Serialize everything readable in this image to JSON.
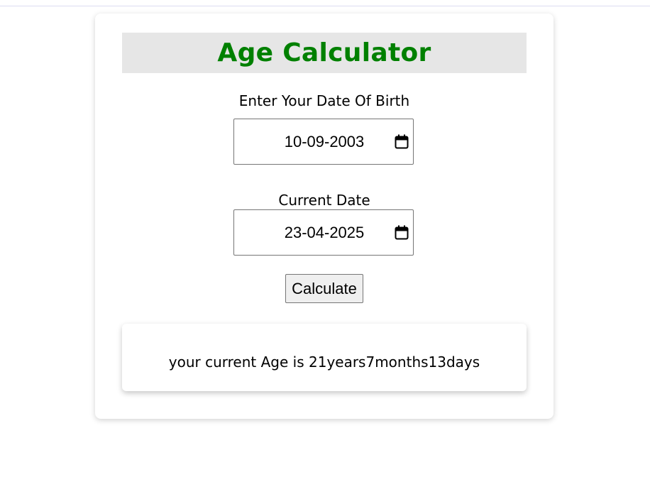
{
  "app": {
    "title": "Age Calculator",
    "accent_color": "#008000"
  },
  "form": {
    "dob_label": "Enter Your Date Of Birth",
    "dob_value": "10-09-2003",
    "current_label": "Current Date",
    "current_value": "23-04-2025",
    "calendar_icon": "calendar-icon",
    "calculate_label": "Calculate"
  },
  "result": {
    "text": "your current Age is 21years7months13days"
  }
}
